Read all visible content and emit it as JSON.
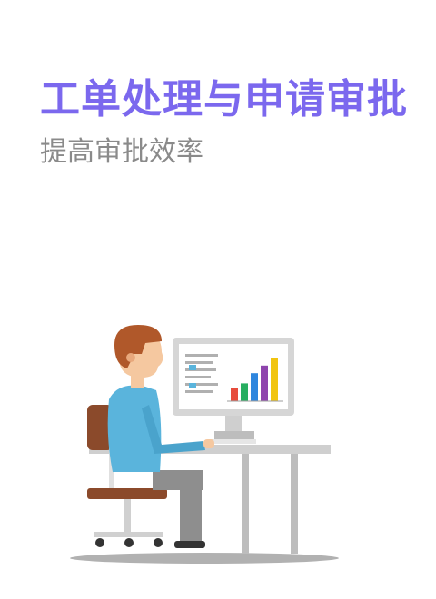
{
  "header": {
    "title": "工单处理与申请审批",
    "subtitle": "提高审批效率"
  },
  "illustration": {
    "icon": "office-worker-at-computer-icon",
    "colors": {
      "accent": "#7b68ee",
      "skin": "#f5c8a0",
      "hair": "#b0582a",
      "shirt": "#5ab4dc",
      "pants": "#8e8e8e",
      "chair": "#8b4a2b",
      "desk": "#c8c8c8",
      "monitor": "#d9d9d9"
    },
    "screen_bars": {
      "values": [
        0.25,
        0.35,
        0.55,
        0.7,
        0.85
      ],
      "colors": [
        "#e74c3c",
        "#27ae60",
        "#2e86de",
        "#8e44ad",
        "#f1c40f"
      ]
    }
  }
}
